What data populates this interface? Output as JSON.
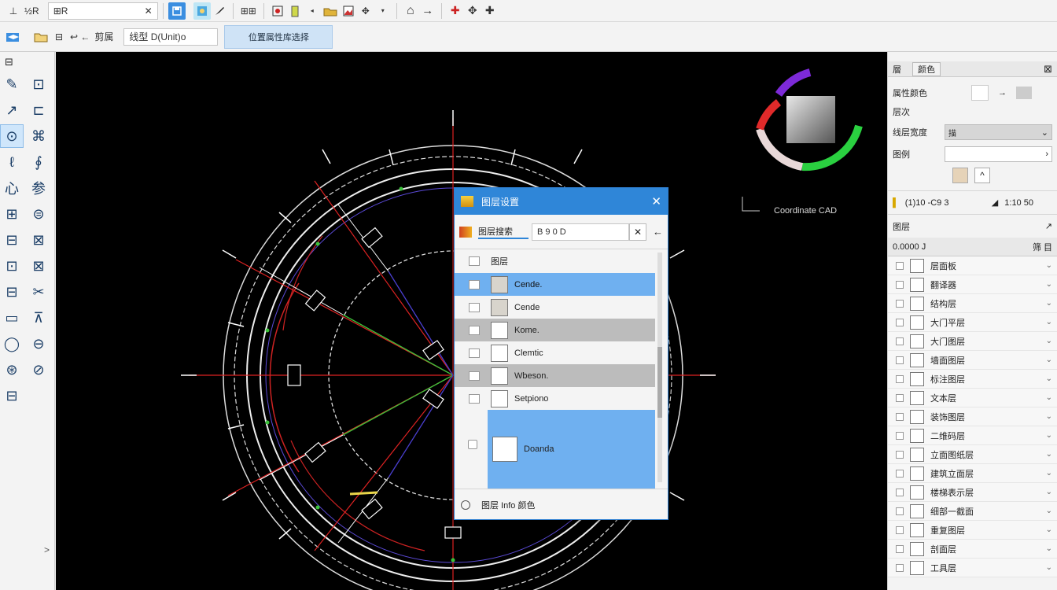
{
  "toolbar1": {
    "tool_a": "⊥",
    "tool_b": "½R",
    "search_value": "⊞R",
    "clear": "✕",
    "layer_btn": "⊞⊞",
    "nav_a": "⌂",
    "nav_b": "→",
    "zoom_a": "✚",
    "zoom_b": "✥",
    "zoom_c": "✚"
  },
  "toolbar2": {
    "open_label": "⊟",
    "back_label": "↩ ←",
    "font_label": "剪属",
    "style_value": "线型 D(Unit)o",
    "tab_label": "位置属性库选择"
  },
  "left_tools": [
    "✎",
    "⊡",
    "↗",
    "⊏",
    "⊙",
    "⌘",
    "ℓ",
    "∮",
    "心",
    "参",
    "⊞",
    "⊜",
    "⊟",
    "⊠",
    "⊡",
    "⊠",
    "⊟",
    "✂",
    "▭",
    "⊼",
    "◯",
    "⊖",
    "⊛",
    "⊘",
    "⊟"
  ],
  "left_footer": ">",
  "canvas": {
    "watermark": "Coordinate CAD"
  },
  "dialog": {
    "title": "图层设置",
    "close": "✕",
    "search_label": "图层搜索",
    "search_value": "B 9 0 D",
    "clear": "✕",
    "back": "←",
    "header_label": "图层",
    "rows": [
      {
        "label": "Cende."
      },
      {
        "label": "Cende"
      },
      {
        "label": "Kome."
      },
      {
        "label": "Clemtic"
      },
      {
        "label": "Wbeson."
      },
      {
        "label": "Setpiono"
      }
    ],
    "big_row_label": "Doanda",
    "footer": "图层 Info 颜色"
  },
  "right_panel": {
    "header_a": "層",
    "header_b": "颜色",
    "close": "⊠",
    "rows": [
      {
        "label": "属性颜色"
      },
      {
        "label": "层次"
      },
      {
        "label": "线层宽度"
      },
      {
        "label": "图例"
      }
    ],
    "line_width_value": "描",
    "coord_label": "(1)10 -C9 3",
    "coord_value": "1:10 50",
    "layer_section": "图层",
    "layer_header_left": "0.0000 J",
    "layer_header_right": "筛 目",
    "items": [
      {
        "label": "层面板"
      },
      {
        "label": "翻译器"
      },
      {
        "label": "结构层"
      },
      {
        "label": "大门平层"
      },
      {
        "label": "大门图层"
      },
      {
        "label": "墙面图层"
      },
      {
        "label": "标注图层"
      },
      {
        "label": "文本层"
      },
      {
        "label": "装饰图层"
      },
      {
        "label": "二维码层"
      },
      {
        "label": "立面图纸层"
      },
      {
        "label": "建筑立面层"
      },
      {
        "label": "楼梯表示层"
      },
      {
        "label": "细部一截面"
      },
      {
        "label": "重复图层"
      },
      {
        "label": "剖面层"
      },
      {
        "label": "工具层"
      }
    ]
  }
}
